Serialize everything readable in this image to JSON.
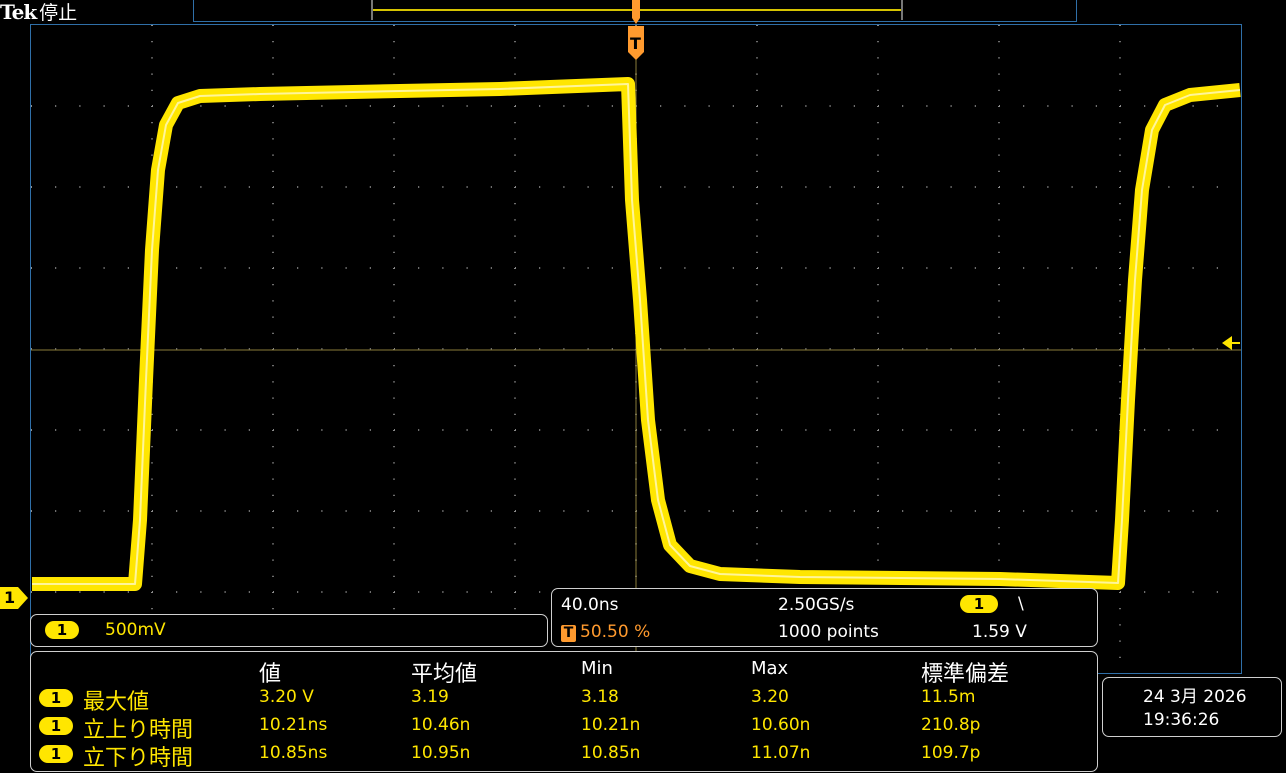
{
  "header": {
    "brand": "Tek",
    "state": "停止"
  },
  "trigger_marker": "T",
  "channel_marker": "1",
  "channel_settings": {
    "channel": "1",
    "scale": "500mV"
  },
  "acquisition": {
    "time_scale": "40.0ns",
    "sample_rate": "2.50GS/s",
    "trigger_position": "50.50 %",
    "record_length": "1000 points",
    "trigger_channel": "1",
    "trigger_slope": "\\",
    "trigger_level": "1.59 V"
  },
  "measurements": {
    "columns": [
      "値",
      "平均値",
      "Min",
      "Max",
      "標準偏差"
    ],
    "rows": [
      {
        "channel": "1",
        "name": "最大値",
        "value": "3.20 V",
        "mean": "3.19",
        "min": "3.18",
        "max": "3.20",
        "stddev": "11.5m"
      },
      {
        "channel": "1",
        "name": "立上り時間",
        "value": "10.21ns",
        "mean": "10.46n",
        "min": "10.21n",
        "max": "10.60n",
        "stddev": "210.8p"
      },
      {
        "channel": "1",
        "name": "立下り時間",
        "value": "10.85ns",
        "mean": "10.95n",
        "min": "10.85n",
        "max": "11.07n",
        "stddev": "109.7p"
      }
    ]
  },
  "datetime": {
    "date": "24 3月 2026",
    "time": "19:36:26"
  },
  "colors": {
    "trace": "#ffe600",
    "trigger": "#ff9a2e",
    "grid": "#8a8a8a",
    "frame": "#2f6fa8"
  }
}
